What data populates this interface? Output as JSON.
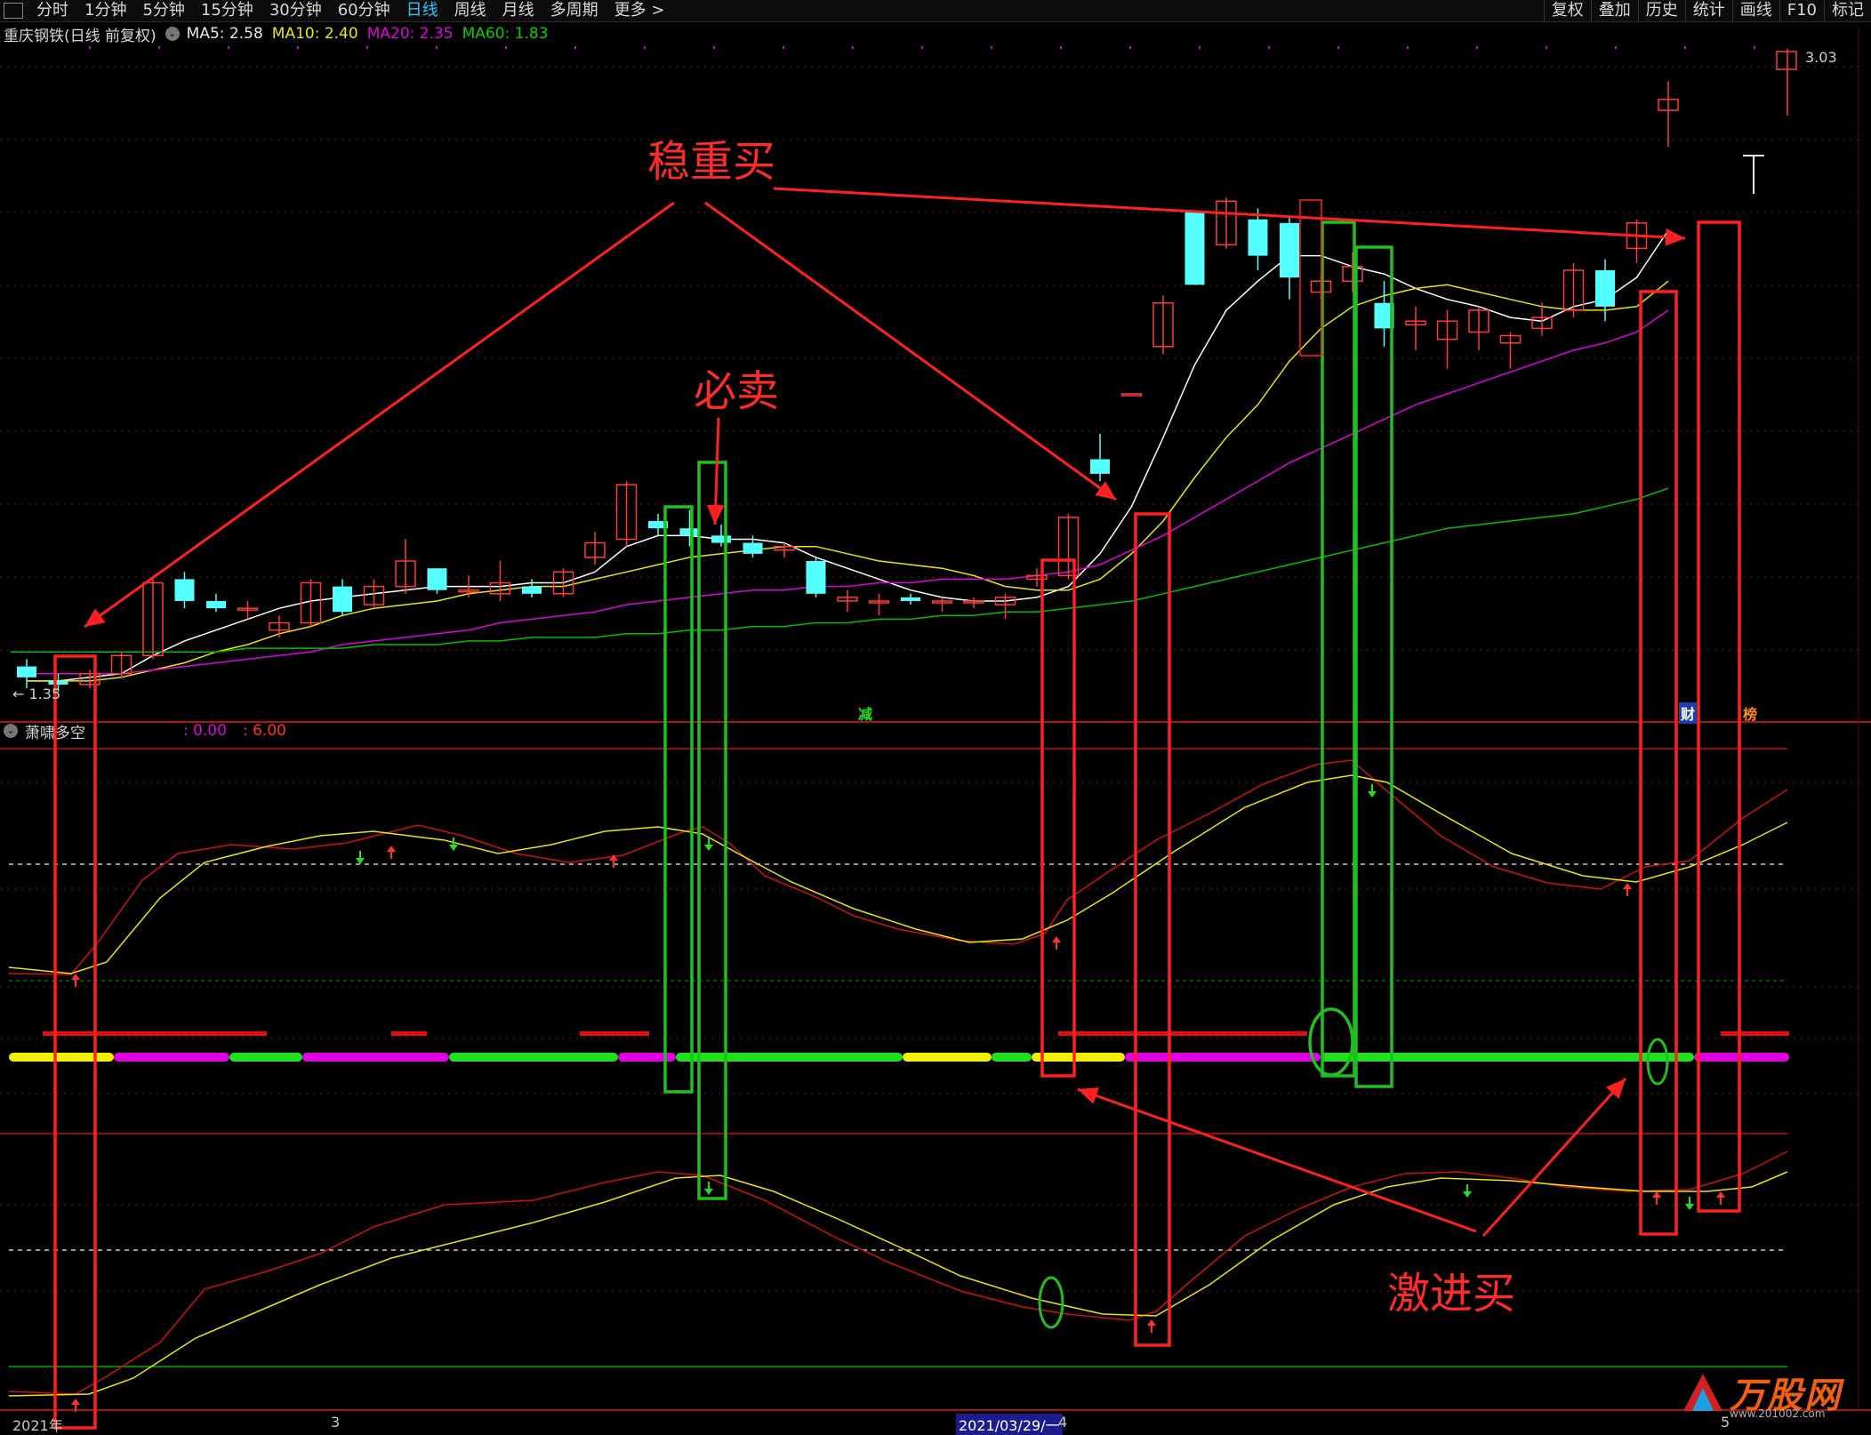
{
  "toolbar": {
    "left_items": [
      "分时",
      "1分钟",
      "5分钟",
      "15分钟",
      "30分钟",
      "60分钟",
      "日线",
      "周线",
      "月线",
      "多周期",
      "更多 >"
    ],
    "active_item": "日线",
    "right_items": [
      "复权",
      "叠加",
      "历史",
      "统计",
      "画线",
      "F10",
      "标记"
    ]
  },
  "infobar": {
    "stock": "重庆钢铁(日线 前复权)",
    "ma5": "MA5: 2.58",
    "ma10": "MA10: 2.40",
    "ma20": "MA20: 2.35",
    "ma60": "MA60: 1.83"
  },
  "indicator": {
    "name": "萧啸多空",
    "value1": ": 0.00",
    "value2": ": 6.00"
  },
  "price_labels": {
    "high": "3.03",
    "low": "1.35"
  },
  "tags": {
    "jian": "减",
    "cai": "财",
    "bang": "榜"
  },
  "x_labels": [
    "2021年",
    "3",
    "2021/03/29/一",
    "4",
    "5"
  ],
  "annotations": {
    "steady_buy": "稳重买",
    "must_sell": "必卖",
    "aggressive_buy": "激进买"
  },
  "watermark": {
    "logo": "万股网",
    "url": "www.201002.com"
  },
  "colors": {
    "up": "#ff3b3b",
    "down": "#54ffff",
    "ma5": "#ffffff",
    "ma10": "#e8e800",
    "ma20": "#e000e0",
    "ma60": "#00c000",
    "annotation": "#ff2a2a",
    "green_box": "#1fc01f"
  },
  "chart_data": {
    "type": "candlestick",
    "title": "重庆钢铁(日线 前复权)",
    "price_range": [
      1.35,
      3.03
    ],
    "candles_ohlc": [
      [
        1.42,
        1.44,
        1.36,
        1.39
      ],
      [
        1.38,
        1.4,
        1.35,
        1.37
      ],
      [
        1.37,
        1.41,
        1.36,
        1.4
      ],
      [
        1.4,
        1.46,
        1.39,
        1.45
      ],
      [
        1.45,
        1.66,
        1.44,
        1.65
      ],
      [
        1.66,
        1.68,
        1.58,
        1.6
      ],
      [
        1.6,
        1.62,
        1.57,
        1.58
      ],
      [
        1.58,
        1.6,
        1.55,
        1.58
      ],
      [
        1.52,
        1.56,
        1.5,
        1.54
      ],
      [
        1.54,
        1.66,
        1.53,
        1.65
      ],
      [
        1.64,
        1.66,
        1.56,
        1.57
      ],
      [
        1.59,
        1.66,
        1.58,
        1.64
      ],
      [
        1.64,
        1.77,
        1.62,
        1.71
      ],
      [
        1.69,
        1.69,
        1.62,
        1.63
      ],
      [
        1.63,
        1.67,
        1.61,
        1.63
      ],
      [
        1.62,
        1.71,
        1.6,
        1.65
      ],
      [
        1.64,
        1.66,
        1.61,
        1.62
      ],
      [
        1.62,
        1.69,
        1.61,
        1.68
      ],
      [
        1.72,
        1.79,
        1.7,
        1.76
      ],
      [
        1.77,
        1.93,
        1.75,
        1.92
      ],
      [
        1.82,
        1.84,
        1.78,
        1.8
      ],
      [
        1.8,
        1.85,
        1.75,
        1.78
      ],
      [
        1.78,
        1.81,
        1.75,
        1.76
      ],
      [
        1.76,
        1.78,
        1.72,
        1.73
      ],
      [
        1.74,
        1.76,
        1.72,
        1.75
      ],
      [
        1.71,
        1.72,
        1.61,
        1.62
      ],
      [
        1.6,
        1.63,
        1.57,
        1.61
      ],
      [
        1.6,
        1.62,
        1.56,
        1.6
      ],
      [
        1.61,
        1.62,
        1.59,
        1.6
      ],
      [
        1.6,
        1.61,
        1.57,
        1.6
      ],
      [
        1.6,
        1.61,
        1.58,
        1.6
      ],
      [
        1.59,
        1.62,
        1.55,
        1.61
      ],
      [
        1.66,
        1.69,
        1.64,
        1.67
      ],
      [
        1.67,
        1.84,
        1.66,
        1.83
      ],
      [
        1.99,
        2.06,
        1.93,
        1.95
      ],
      [
        2.17,
        2.17,
        2.17,
        2.17
      ],
      [
        2.3,
        2.44,
        2.28,
        2.42
      ],
      [
        2.67,
        2.67,
        2.47,
        2.47
      ],
      [
        2.58,
        2.71,
        2.57,
        2.7
      ],
      [
        2.65,
        2.68,
        2.51,
        2.55
      ],
      [
        2.64,
        2.66,
        2.43,
        2.49
      ],
      [
        2.45,
        2.5,
        2.43,
        2.48
      ],
      [
        2.48,
        2.56,
        2.45,
        2.52
      ],
      [
        2.42,
        2.48,
        2.3,
        2.35
      ],
      [
        2.36,
        2.41,
        2.29,
        2.37
      ],
      [
        2.32,
        2.4,
        2.24,
        2.37
      ],
      [
        2.34,
        2.41,
        2.29,
        2.4
      ],
      [
        2.31,
        2.34,
        2.24,
        2.33
      ],
      [
        2.35,
        2.42,
        2.33,
        2.38
      ],
      [
        2.4,
        2.53,
        2.38,
        2.51
      ],
      [
        2.51,
        2.54,
        2.37,
        2.41
      ],
      [
        2.57,
        2.65,
        2.53,
        2.64
      ],
      [
        2.95,
        3.03,
        2.85,
        2.98
      ]
    ],
    "series": [
      {
        "name": "MA5",
        "values": [
          1.38,
          1.38,
          1.39,
          1.4,
          1.45,
          1.49,
          1.52,
          1.55,
          1.58,
          1.6,
          1.61,
          1.62,
          1.63,
          1.64,
          1.64,
          1.64,
          1.65,
          1.65,
          1.68,
          1.75,
          1.78,
          1.78,
          1.77,
          1.77,
          1.76,
          1.72,
          1.69,
          1.66,
          1.63,
          1.61,
          1.6,
          1.6,
          1.61,
          1.64,
          1.73,
          1.86,
          2.05,
          2.25,
          2.4,
          2.48,
          2.55,
          2.55,
          2.52,
          2.5,
          2.46,
          2.43,
          2.41,
          2.38,
          2.37,
          2.41,
          2.43,
          2.49,
          2.62
        ]
      },
      {
        "name": "MA10",
        "values": [
          1.38,
          1.38,
          1.38,
          1.39,
          1.41,
          1.43,
          1.46,
          1.48,
          1.51,
          1.53,
          1.56,
          1.58,
          1.59,
          1.6,
          1.62,
          1.63,
          1.64,
          1.64,
          1.66,
          1.68,
          1.7,
          1.72,
          1.73,
          1.74,
          1.75,
          1.75,
          1.73,
          1.71,
          1.7,
          1.69,
          1.67,
          1.64,
          1.63,
          1.63,
          1.66,
          1.73,
          1.82,
          1.94,
          2.05,
          2.14,
          2.26,
          2.35,
          2.41,
          2.44,
          2.46,
          2.47,
          2.45,
          2.43,
          2.41,
          2.4,
          2.4,
          2.41,
          2.48
        ]
      },
      {
        "name": "MA20",
        "values": [
          1.4,
          1.4,
          1.4,
          1.4,
          1.41,
          1.42,
          1.43,
          1.44,
          1.45,
          1.46,
          1.48,
          1.49,
          1.5,
          1.51,
          1.52,
          1.54,
          1.55,
          1.56,
          1.57,
          1.59,
          1.6,
          1.61,
          1.62,
          1.63,
          1.63,
          1.64,
          1.64,
          1.65,
          1.65,
          1.66,
          1.66,
          1.66,
          1.67,
          1.68,
          1.7,
          1.74,
          1.78,
          1.83,
          1.88,
          1.93,
          1.98,
          2.02,
          2.06,
          2.1,
          2.14,
          2.17,
          2.2,
          2.23,
          2.26,
          2.29,
          2.31,
          2.34,
          2.4
        ]
      },
      {
        "name": "MA60",
        "values": [
          1.46,
          1.46,
          1.46,
          1.46,
          1.46,
          1.46,
          1.46,
          1.47,
          1.47,
          1.47,
          1.47,
          1.48,
          1.48,
          1.48,
          1.49,
          1.49,
          1.5,
          1.5,
          1.5,
          1.51,
          1.51,
          1.52,
          1.52,
          1.53,
          1.53,
          1.54,
          1.54,
          1.55,
          1.55,
          1.56,
          1.56,
          1.57,
          1.57,
          1.58,
          1.59,
          1.6,
          1.62,
          1.64,
          1.66,
          1.68,
          1.7,
          1.72,
          1.74,
          1.76,
          1.78,
          1.8,
          1.81,
          1.82,
          1.83,
          1.84,
          1.86,
          1.88,
          1.91
        ]
      }
    ]
  }
}
